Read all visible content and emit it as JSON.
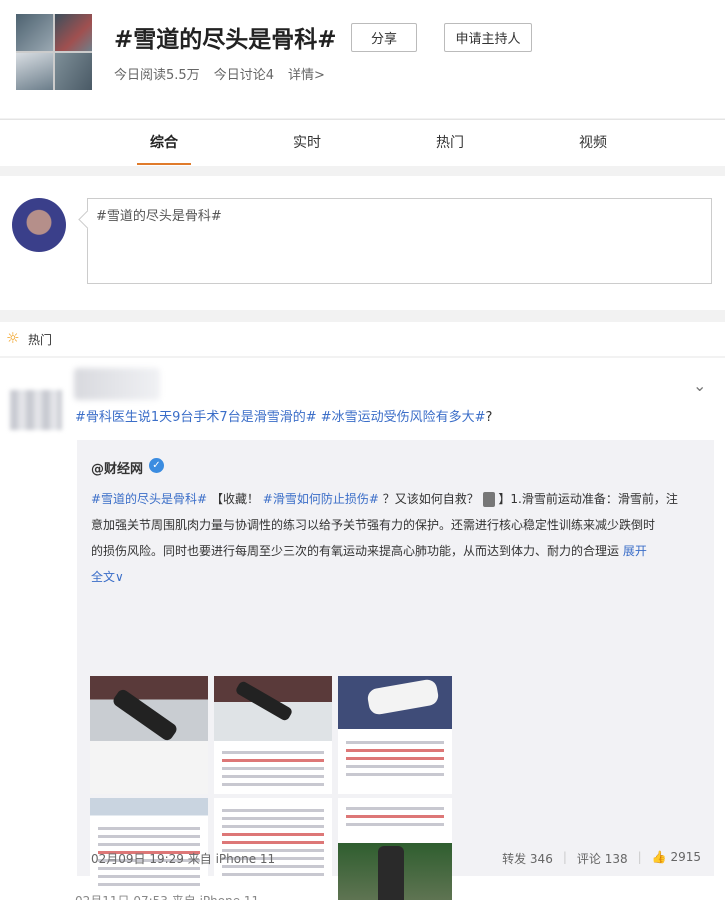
{
  "header": {
    "title": "#雪道的尽头是骨科#",
    "share_label": "分享",
    "host_label": "申请主持人",
    "reads": "今日阅读5.5万",
    "discussions": "今日讨论4",
    "details": "详情>"
  },
  "tabs": [
    "综合",
    "实时",
    "热门",
    "视频"
  ],
  "composer": {
    "text": "#雪道的尽头是骨科#"
  },
  "hot": {
    "label": "热门"
  },
  "post": {
    "text_link1": "#骨科医生说1天9台手术7台是滑雪滑的#",
    "text_link2": "#冰雪运动受伤风险有多大#",
    "text_tail": "?",
    "repost": {
      "author": "@财经网",
      "verify_icon": "✓",
      "line1_link1": "#雪道的尽头是骨科#",
      "line1_text1": "【收藏！",
      "line1_link2": "#滑雪如何防止损伤#",
      "line1_text2": "？又该如何自救？",
      "line1_text3": "】1.滑雪前运动准备：滑雪前，注",
      "line2": "意加强关节周围肌肉力量与协调性的练习以给予关节强有力的保护。还需进行核心稳定性训练来减少跌倒时",
      "line3": "的损伤风险。同时也要进行每周至少三次的有氧运动来提高心肺功能，从而达到体力、耐力的合理运",
      "expand": "展开",
      "full": "全文∨",
      "time": "02月09日 19:29 来自 iPhone 11",
      "repost_count": "转发 346",
      "comment_count": "评论 138",
      "like_count": "2915"
    },
    "next_time": "02月11日 07:53 来自 iPhone 11"
  }
}
